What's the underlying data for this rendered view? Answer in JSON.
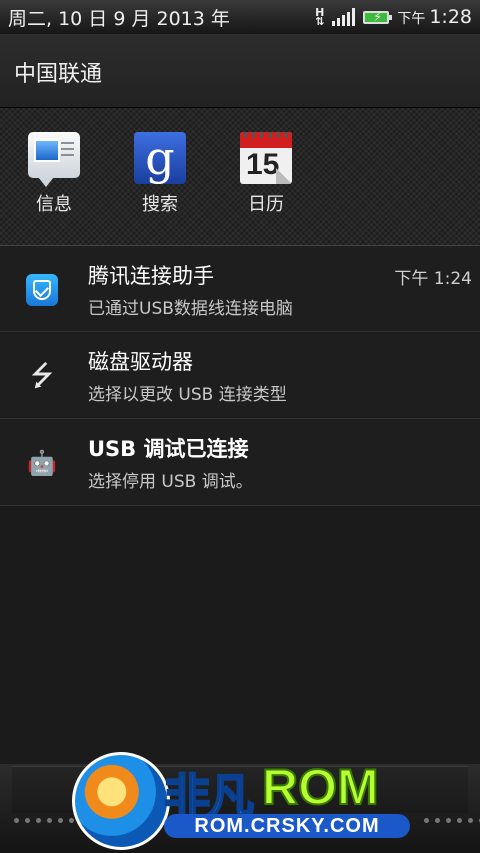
{
  "status_bar": {
    "date": "周二, 10 日 9 月 2013 年",
    "network_type": "H",
    "time_period": "下午",
    "time": "1:28",
    "icons": [
      "network-h-icon",
      "signal-icon",
      "battery-charging-icon"
    ]
  },
  "carrier": {
    "name": "中国联通"
  },
  "quick_apps": [
    {
      "label": "信息",
      "icon": "messages-icon"
    },
    {
      "label": "搜索",
      "icon": "google-search-icon",
      "glyph": "g"
    },
    {
      "label": "日历",
      "icon": "calendar-icon",
      "day": "15"
    }
  ],
  "notifications": [
    {
      "title": "腾讯连接助手",
      "subtitle": "已通过USB数据线连接电脑",
      "time": "下午 1:24",
      "icon": "tencent-connect-icon"
    },
    {
      "title": "磁盘驱动器",
      "subtitle": "选择以更改 USB 连接类型",
      "icon": "usb-icon",
      "glyph": "⭍"
    },
    {
      "title": "USB 调试已连接",
      "subtitle": "选择停用 USB 调试。",
      "icon": "android-debug-icon",
      "glyph": "🤖"
    }
  ],
  "watermark": {
    "brand_cn": "非凡",
    "brand_rom": "ROM",
    "url": "ROM.CRSKY.COM"
  },
  "colors": {
    "background": "#1b1b1b",
    "accent_blue": "#1a78d6",
    "battery_green": "#3dbb3d",
    "logo_green": "#b5ff32"
  }
}
